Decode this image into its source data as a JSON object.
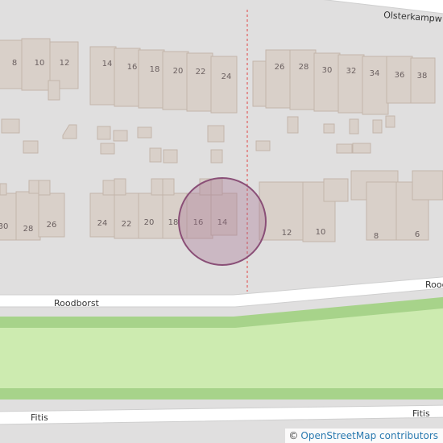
{
  "streets": {
    "top": "Olsterkampw",
    "middle_left": "Roodborst",
    "middle_right": "Rood",
    "bottom_left": "Fitis",
    "bottom_right": "Fitis"
  },
  "house_numbers": {
    "top_row": [
      "8",
      "10",
      "12",
      "14",
      "16",
      "18",
      "20",
      "22",
      "24",
      "26",
      "28",
      "30",
      "32",
      "34",
      "36",
      "38"
    ],
    "lower_row": [
      "30",
      "28",
      "26",
      "24",
      "22",
      "20",
      "18",
      "16",
      "14",
      "12",
      "10",
      "8",
      "6"
    ]
  },
  "attribution": {
    "symbol": "©",
    "text": "OpenStreetMap contributors"
  },
  "colors": {
    "land": "#e0dfdf",
    "road": "#ffffff",
    "park": "#cdebb0",
    "park_border": "#a7d38a",
    "building": "#d9d0c9",
    "boundary": "#e06060",
    "marker_fill": "#a3708f",
    "marker_stroke": "#8a4f77"
  }
}
